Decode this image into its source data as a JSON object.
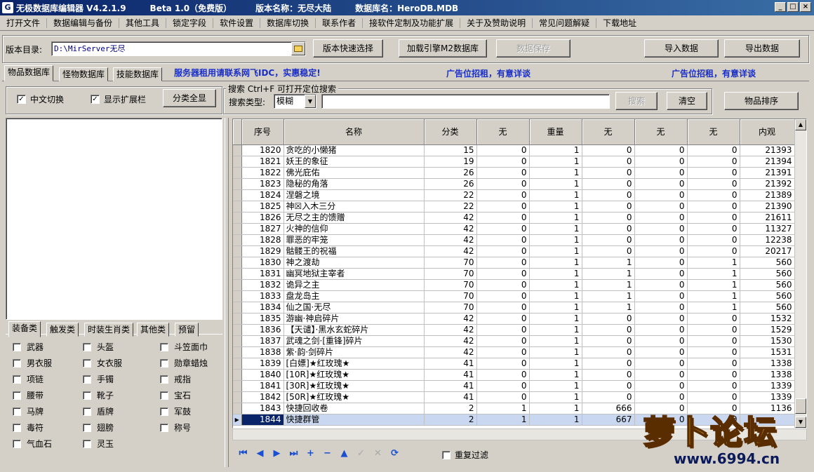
{
  "title_bar": {
    "app_name": "无极数据库编辑器 V4.2.1.9",
    "edition": "Beta 1.0（免费版）",
    "version_name": "版本名称：无尽大陆",
    "db_name": "数据库名：HeroDB.MDB",
    "controls": [
      "_",
      "□",
      "×"
    ]
  },
  "menu": [
    "打开文件",
    "数据编辑与备份",
    "其他工具",
    "锁定字段",
    "软件设置",
    "数据库切换",
    "联系作者",
    "接软件定制及功能扩展",
    "关于及赞助说明",
    "常见问题解疑",
    "下载地址"
  ],
  "toolbar": {
    "dir_label": "版本目录:",
    "dir_value": "D:\\MirServer无尽",
    "quick_select": "版本快速选择",
    "load_m2": "加载引擎M2数据库",
    "save_data": "数据保存",
    "import": "导入数据",
    "export": "导出数据"
  },
  "tabs": [
    "物品数据库",
    "怪物数据库",
    "技能数据库"
  ],
  "ads": [
    "服务器租用请联系网飞IDC，实惠稳定!",
    "广告位招租，有意详谈",
    "广告位招租，有意详谈"
  ],
  "options": {
    "chinese_switch": "中文切换",
    "show_ext": "显示扩展栏",
    "show_all": "分类全显",
    "checkmark": "✓"
  },
  "search": {
    "group_label": "搜索  Ctrl+F 可打开定位搜索",
    "type_label": "搜索类型:",
    "type_value": "模糊",
    "dropdown_arrow": "▼",
    "search_btn": "搜索",
    "clear_btn": "清空",
    "sort_btn": "物品排序"
  },
  "grid": {
    "columns": [
      "序号",
      "名称",
      "分类",
      "无",
      "重量",
      "无",
      "无",
      "无",
      "内观"
    ],
    "selected_marker": "▶",
    "scroll_up": "▲",
    "scroll_down": "▼",
    "rows": [
      [
        "1820",
        "贪吃的小懒猪",
        "15",
        "0",
        "1",
        "0",
        "0",
        "0",
        "21393"
      ],
      [
        "1821",
        "妖王的象征",
        "19",
        "0",
        "1",
        "0",
        "0",
        "0",
        "21394"
      ],
      [
        "1822",
        "佛光庇佑",
        "26",
        "0",
        "1",
        "0",
        "0",
        "0",
        "21391"
      ],
      [
        "1823",
        "隐秘的角落",
        "26",
        "0",
        "1",
        "0",
        "0",
        "0",
        "21392"
      ],
      [
        "1824",
        "涅磐之境",
        "22",
        "0",
        "1",
        "0",
        "0",
        "0",
        "21389"
      ],
      [
        "1825",
        "神☒入木三分",
        "22",
        "0",
        "1",
        "0",
        "0",
        "0",
        "21390"
      ],
      [
        "1826",
        "无尽之主的馈赠",
        "42",
        "0",
        "1",
        "0",
        "0",
        "0",
        "21611"
      ],
      [
        "1827",
        "火神的信仰",
        "42",
        "0",
        "1",
        "0",
        "0",
        "0",
        "11327"
      ],
      [
        "1828",
        "罪恶的牢笼",
        "42",
        "0",
        "1",
        "0",
        "0",
        "0",
        "12238"
      ],
      [
        "1829",
        "骷髅王的祝福",
        "42",
        "0",
        "1",
        "0",
        "0",
        "0",
        "20217"
      ],
      [
        "1830",
        "神之渡劫",
        "70",
        "0",
        "1",
        "1",
        "0",
        "1",
        "560"
      ],
      [
        "1831",
        "幽冥地狱主宰者",
        "70",
        "0",
        "1",
        "1",
        "0",
        "1",
        "560"
      ],
      [
        "1832",
        "诡异之主",
        "70",
        "0",
        "1",
        "1",
        "0",
        "1",
        "560"
      ],
      [
        "1833",
        "盘龙岛主",
        "70",
        "0",
        "1",
        "1",
        "0",
        "1",
        "560"
      ],
      [
        "1834",
        "仙之国·无尽",
        "70",
        "0",
        "1",
        "1",
        "0",
        "1",
        "560"
      ],
      [
        "1835",
        "游幽·神启碎片",
        "42",
        "0",
        "1",
        "0",
        "0",
        "0",
        "1532"
      ],
      [
        "1836",
        "【天谴】·黑水玄蛇碎片",
        "42",
        "0",
        "1",
        "0",
        "0",
        "0",
        "1529"
      ],
      [
        "1837",
        "武魂之剑·[重锋]碎片",
        "42",
        "0",
        "1",
        "0",
        "0",
        "0",
        "1530"
      ],
      [
        "1838",
        "紫·韵·剑碎片",
        "42",
        "0",
        "1",
        "0",
        "0",
        "0",
        "1531"
      ],
      [
        "1839",
        "[白嫖]★红玫瑰★",
        "41",
        "0",
        "1",
        "0",
        "0",
        "0",
        "1338"
      ],
      [
        "1840",
        "[10R]★红玫瑰★",
        "41",
        "0",
        "1",
        "0",
        "0",
        "0",
        "1338"
      ],
      [
        "1841",
        "[30R]★红玫瑰★",
        "41",
        "0",
        "1",
        "0",
        "0",
        "0",
        "1339"
      ],
      [
        "1842",
        "[50R]★红玫瑰★",
        "41",
        "0",
        "1",
        "0",
        "0",
        "0",
        "1339"
      ],
      [
        "1843",
        "快捷回收卷",
        "2",
        "1",
        "1",
        "666",
        "0",
        "0",
        "1136"
      ],
      [
        "1844",
        "快捷群管",
        "2",
        "1",
        "1",
        "667",
        "0",
        "0",
        ""
      ]
    ]
  },
  "categories": {
    "tabs": [
      "装备类",
      "触发类",
      "时装生肖类",
      "其他类",
      "预留"
    ],
    "items": [
      "武器",
      "头盔",
      "斗笠面巾",
      "男衣服",
      "女衣服",
      "勋章蜡烛",
      "项链",
      "手镯",
      "戒指",
      "腰带",
      "靴子",
      "宝石",
      "马牌",
      "盾牌",
      "军鼓",
      "毒符",
      "翅膀",
      "称号",
      "气血石",
      "灵玉"
    ]
  },
  "nav": {
    "icons": [
      "⏮",
      "◀",
      "▶",
      "⏭",
      "+",
      "−",
      "▲",
      "✓",
      "✕",
      "⟳"
    ],
    "dup_filter": "重复过滤"
  },
  "watermark": {
    "brand": "萝卜论坛",
    "url": "www.6994.cn"
  },
  "colors": {
    "title_bar": "#0a246a",
    "ad_text": "#1a2ec8",
    "selection": "#0a246a"
  }
}
